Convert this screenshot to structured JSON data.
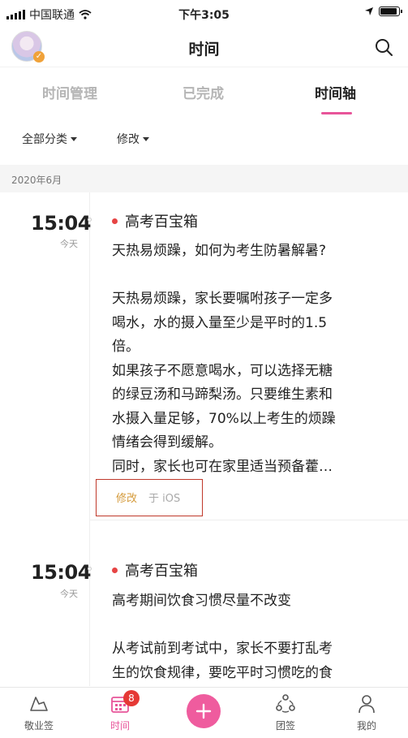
{
  "status_bar": {
    "carrier": "中国联通",
    "time": "下午3:05",
    "battery_level": 0.9
  },
  "header": {
    "title": "时间"
  },
  "tabs": [
    {
      "label": "时间管理",
      "active": false
    },
    {
      "label": "已完成",
      "active": false
    },
    {
      "label": "时间轴",
      "active": true
    }
  ],
  "filters": {
    "category": "全部分类",
    "sort": "修改"
  },
  "section": {
    "month": "2020年6月"
  },
  "entries": [
    {
      "time": "15:04",
      "day": "今天",
      "category": "高考百宝箱",
      "body": "天热易烦躁，如何为考生防暑解暑?\n\n天热易烦躁，家长要嘱咐孩子一定多\n喝水，水的摄入量至少是平时的1.5\n倍。\n如果孩子不愿意喝水，可以选择无糖\n的绿豆汤和马蹄梨汤。只要维生素和\n水摄入量足够，70%以上考生的烦躁\n情绪会得到缓解。\n同时，家长也可在家里适当预备藿…",
      "edit_label": "修改",
      "source_label": "于 iOS"
    },
    {
      "time": "15:04",
      "day": "今天",
      "category": "高考百宝箱",
      "body": "高考期间饮食习惯尽量不改变\n\n从考试前到考试中，家长不要打乱考\n生的饮食规律，要吃平时习惯吃的食"
    }
  ],
  "tabbar": {
    "items": [
      {
        "label": "敬业签",
        "icon": "sign-icon"
      },
      {
        "label": "时间",
        "icon": "calendar-icon",
        "badge": "8"
      },
      {
        "label": "",
        "icon": "plus-icon"
      },
      {
        "label": "团签",
        "icon": "team-icon"
      },
      {
        "label": "我的",
        "icon": "user-icon"
      }
    ]
  },
  "colors": {
    "accent": "#e8559a",
    "fab": "#ef5c9e",
    "category_dot": "#e64444",
    "badge": "#e53935",
    "edit_text": "#d49a3a"
  }
}
